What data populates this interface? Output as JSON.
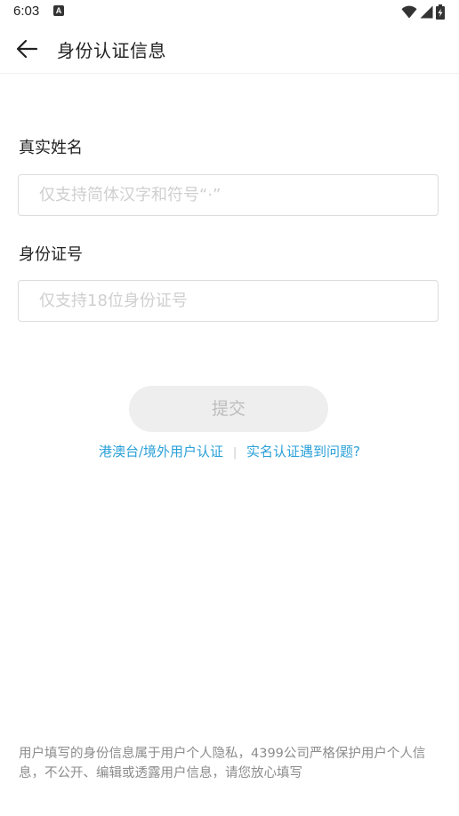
{
  "status_bar": {
    "time": "6:03",
    "notification_badge": "A"
  },
  "header": {
    "title": "身份认证信息"
  },
  "form": {
    "name_label": "真实姓名",
    "name_placeholder": "仅支持简体汉字和符号“·”",
    "name_value": "",
    "id_label": "身份证号",
    "id_placeholder": "仅支持18位身份证号",
    "id_value": "",
    "submit_label": "提交"
  },
  "links": {
    "overseas_label": "港澳台/境外用户认证",
    "separator": "|",
    "problem_label": "实名认证遇到问题?"
  },
  "footer": {
    "privacy_note": "用户填写的身份信息属于用户个人隐私，4399公司严格保护用户个人信息，不公开、编辑或透露用户信息，请您放心填写"
  },
  "colors": {
    "link": "#2aa0d8",
    "button_bg": "#eeeeee",
    "button_text": "#bdbdbd",
    "hint_text": "#8c8c8c"
  },
  "icons": {
    "back": "arrow-left-icon",
    "wifi": "wifi-icon",
    "signal": "signal-icon",
    "battery": "battery-charging-icon"
  }
}
